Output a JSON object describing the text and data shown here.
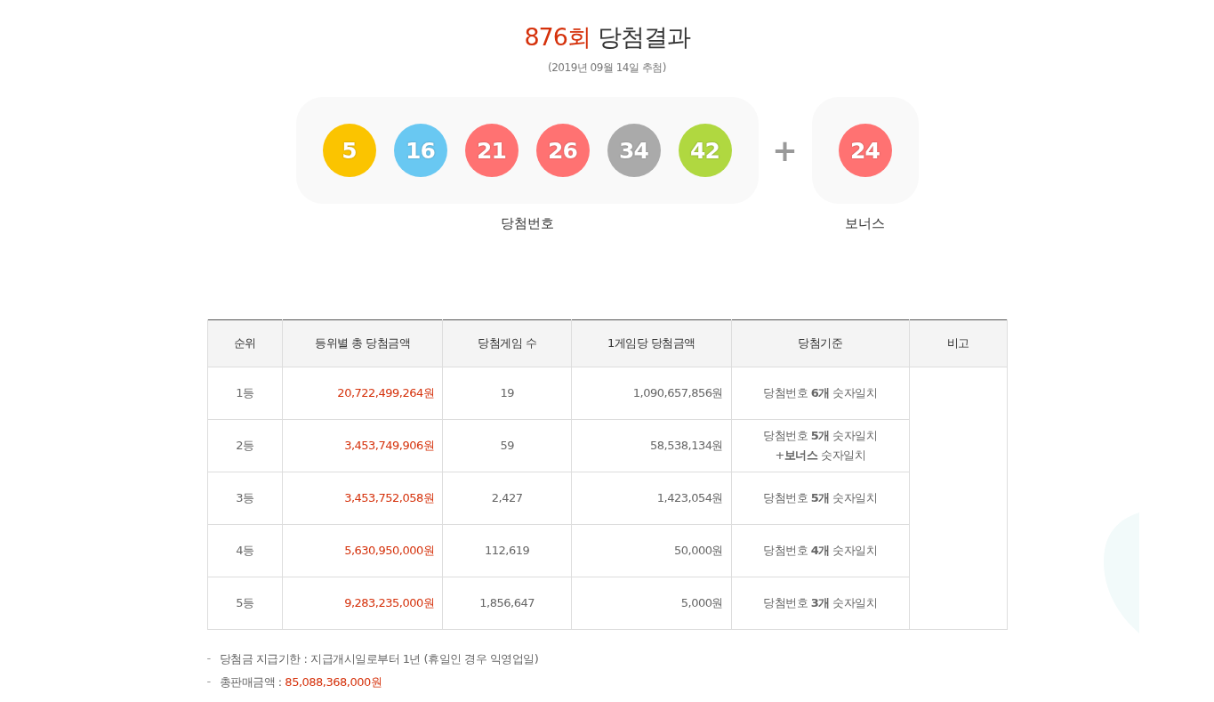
{
  "title": {
    "round": "876회",
    "text": "당첨결과"
  },
  "draw_date": "(2019년 09월 14일 추첨)",
  "winning_numbers": {
    "label": "당첨번호",
    "balls": [
      {
        "number": "5",
        "color": "#fbc400"
      },
      {
        "number": "16",
        "color": "#69c8f2"
      },
      {
        "number": "21",
        "color": "#ff7272"
      },
      {
        "number": "26",
        "color": "#ff7272"
      },
      {
        "number": "34",
        "color": "#aaaaaa"
      },
      {
        "number": "42",
        "color": "#b0d840"
      }
    ]
  },
  "plus": "+",
  "bonus": {
    "label": "보너스",
    "balls": [
      {
        "number": "24",
        "color": "#ff7272"
      }
    ]
  },
  "table": {
    "columns": [
      "순위",
      "등위별 총 당첨금액",
      "당첨게임 수",
      "1게임당 당첨금액",
      "당첨기준",
      "비고"
    ],
    "rows": [
      {
        "rank": "1등",
        "total": "20,722,499,264원",
        "winners": "19",
        "per_game": "1,090,657,856원",
        "criteria": [
          "당첨번호 **6개** 숫자일치"
        ]
      },
      {
        "rank": "2등",
        "total": "3,453,749,906원",
        "winners": "59",
        "per_game": "58,538,134원",
        "criteria": [
          "당첨번호 **5개** 숫자일치",
          "+**보너스** 숫자일치"
        ]
      },
      {
        "rank": "3등",
        "total": "3,453,752,058원",
        "winners": "2,427",
        "per_game": "1,423,054원",
        "criteria": [
          "당첨번호 **5개** 숫자일치"
        ]
      },
      {
        "rank": "4등",
        "total": "5,630,950,000원",
        "winners": "112,619",
        "per_game": "50,000원",
        "criteria": [
          "당첨번호 **4개** 숫자일치"
        ]
      },
      {
        "rank": "5등",
        "total": "9,283,235,000원",
        "winners": "1,856,647",
        "per_game": "5,000원",
        "criteria": [
          "당첨번호 **3개** 숫자일치"
        ]
      }
    ]
  },
  "notes": [
    {
      "bullet": "-",
      "label": "당첨금 지급기한 :",
      "value": "지급개시일로부터 1년 (휴일인 경우 익영업일)",
      "kind": "plain"
    },
    {
      "bullet": "-",
      "label": "총판매금액 :",
      "value": "85,088,368,000원",
      "kind": "amount"
    }
  ]
}
